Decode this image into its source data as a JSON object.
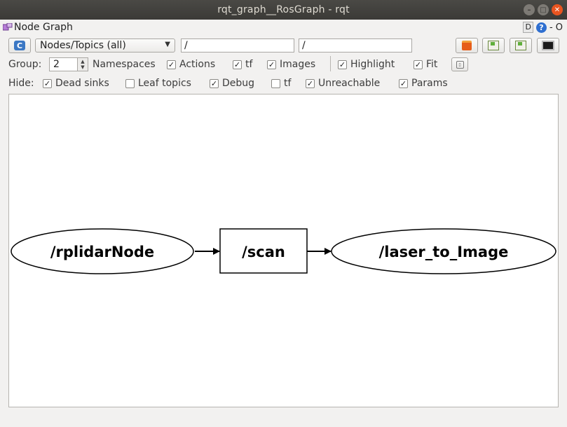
{
  "window": {
    "title": "rqt_graph__RosGraph - rqt"
  },
  "panel": {
    "title": "Node Graph",
    "d_label": "D",
    "help_label": "?",
    "right_text": "- O"
  },
  "toolbar": {
    "refresh_glyph": "C",
    "graph_type": "Nodes/Topics (all)",
    "node_filter": "/",
    "topic_filter": "/"
  },
  "options": {
    "group_label": "Group:",
    "group_value": "2",
    "namespaces": "Namespaces",
    "actions": "Actions",
    "tf": "tf",
    "images": "Images",
    "highlight": "Highlight",
    "fit": "Fit",
    "checks": {
      "namespaces": true,
      "actions": true,
      "tf": true,
      "images": true,
      "highlight": true,
      "fit": true
    }
  },
  "hide": {
    "label": "Hide:",
    "dead_sinks": "Dead sinks",
    "leaf_topics": "Leaf topics",
    "debug": "Debug",
    "tf": "tf",
    "unreachable": "Unreachable",
    "params": "Params",
    "checks": {
      "dead_sinks": true,
      "leaf_topics": false,
      "debug": true,
      "tf": false,
      "unreachable": true,
      "params": true
    }
  },
  "graph": {
    "nodes": [
      {
        "id": "rplidar",
        "label": "/rplidarNode",
        "shape": "ellipse"
      },
      {
        "id": "scan",
        "label": "/scan",
        "shape": "box"
      },
      {
        "id": "laser",
        "label": "/laser_to_Image",
        "shape": "ellipse"
      }
    ],
    "edges": [
      {
        "from": "rplidar",
        "to": "scan"
      },
      {
        "from": "scan",
        "to": "laser"
      }
    ]
  },
  "colors": {
    "titlebar": "#3b3a37",
    "close_button": "#e95420",
    "canvas": "#ffffff"
  },
  "icons": [
    "refresh-icon",
    "open-folder-icon",
    "save-dot-icon",
    "save-image-icon",
    "screenshot-icon",
    "fit-view-icon",
    "help-icon"
  ]
}
